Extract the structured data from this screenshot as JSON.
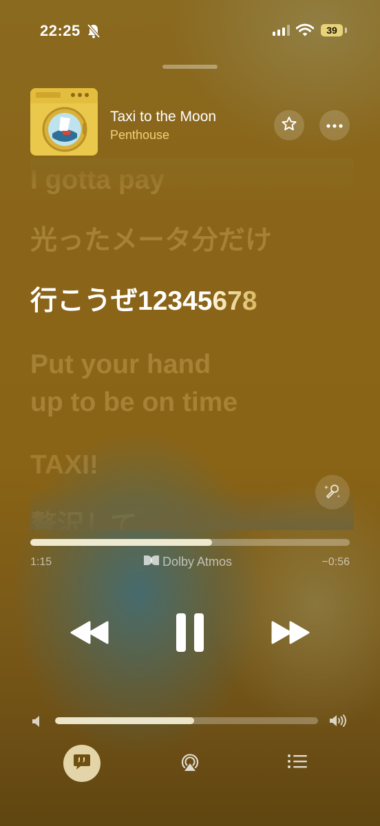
{
  "status": {
    "time": "22:25",
    "battery": "39",
    "icons": [
      "bell-slash-icon",
      "signal-icon",
      "wifi-icon",
      "battery-icon"
    ]
  },
  "now_playing": {
    "title": "Taxi to the Moon",
    "artist": "Penthouse",
    "artwork_label": "Penthouse",
    "favorite_icon": "star-outline-icon",
    "more_icon": "ellipsis-icon"
  },
  "lyrics": {
    "lines": [
      {
        "text": "I gotta pay",
        "state": "past"
      },
      {
        "text": "光ったメータ分だけ",
        "state": "past"
      },
      {
        "text_sung": "行こうぜ12345",
        "text_rest": "678",
        "state": "current"
      },
      {
        "text": "Put your hand",
        "state": "upcoming"
      },
      {
        "text": "up to be on time",
        "state": "upcoming"
      },
      {
        "text": "TAXI!",
        "state": "upcoming"
      },
      {
        "text": "贅沢して",
        "state": "upcoming"
      }
    ],
    "sing_icon": "microphone-sparkle-icon"
  },
  "playback": {
    "elapsed": "1:15",
    "remaining": "−0:56",
    "progress_fraction": 0.57,
    "format_label": "Dolby Atmos",
    "format_icon": "dolby-icon"
  },
  "controls": {
    "rewind_icon": "rewind-icon",
    "pause_icon": "pause-icon",
    "forward_icon": "fast-forward-icon"
  },
  "volume": {
    "level_fraction": 0.53,
    "low_icon": "speaker-low-icon",
    "high_icon": "speaker-high-icon"
  },
  "bottom_bar": {
    "lyrics_icon": "lyrics-bubble-icon",
    "airplay_icon": "airplay-icon",
    "queue_icon": "queue-list-icon"
  },
  "colors": {
    "accent": "#f2d27a",
    "background": "#8a6418"
  }
}
